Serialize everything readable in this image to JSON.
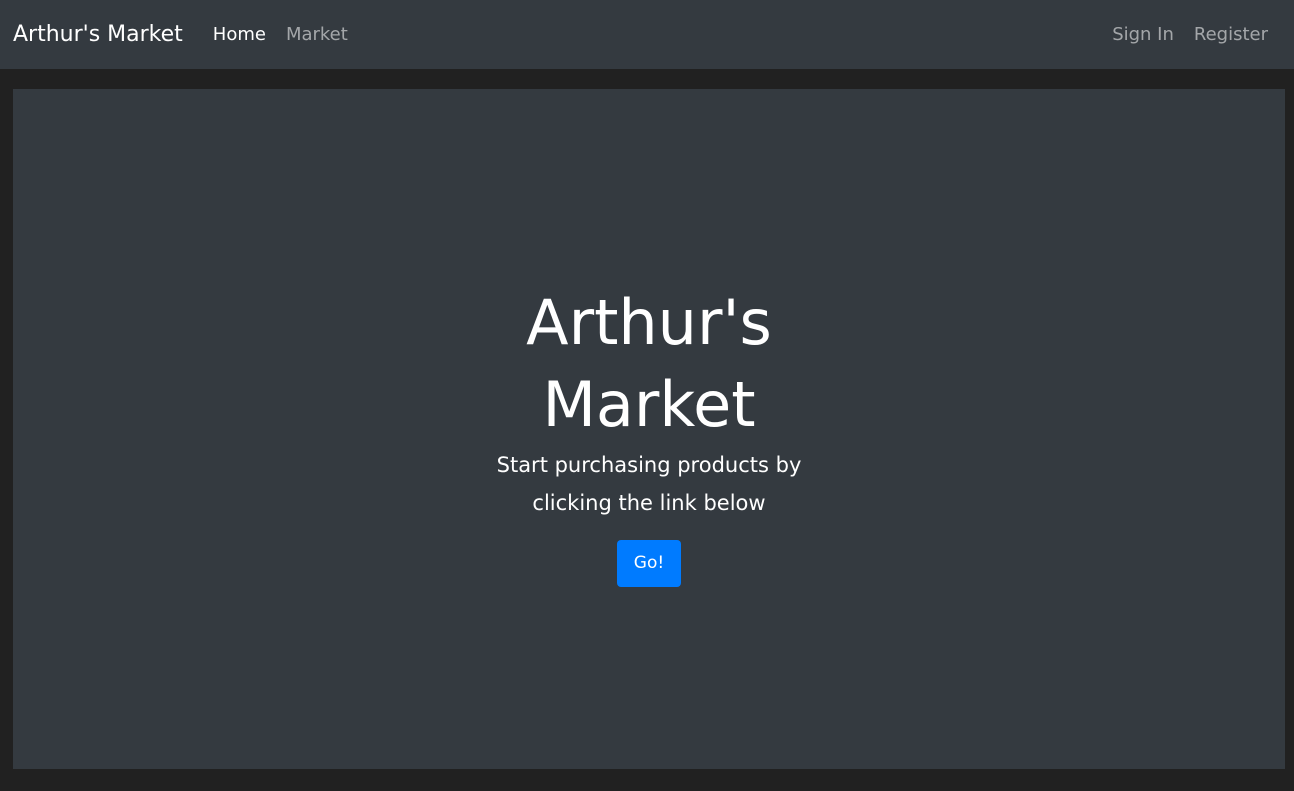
{
  "navbar": {
    "brand": "Arthur's Market",
    "left_links": [
      {
        "label": "Home",
        "active": true
      },
      {
        "label": "Market",
        "active": false
      }
    ],
    "right_links": [
      {
        "label": "Sign In"
      },
      {
        "label": "Register"
      }
    ]
  },
  "hero": {
    "title": "Arthur's Market",
    "subtitle": "Start purchasing products by clicking the link below",
    "button_label": "Go!"
  },
  "colors": {
    "page_background": "#212121",
    "panel_background": "#343a40",
    "primary_button": "#007bff",
    "text": "#ffffff",
    "muted_link": "rgba(255,255,255,0.55)"
  }
}
